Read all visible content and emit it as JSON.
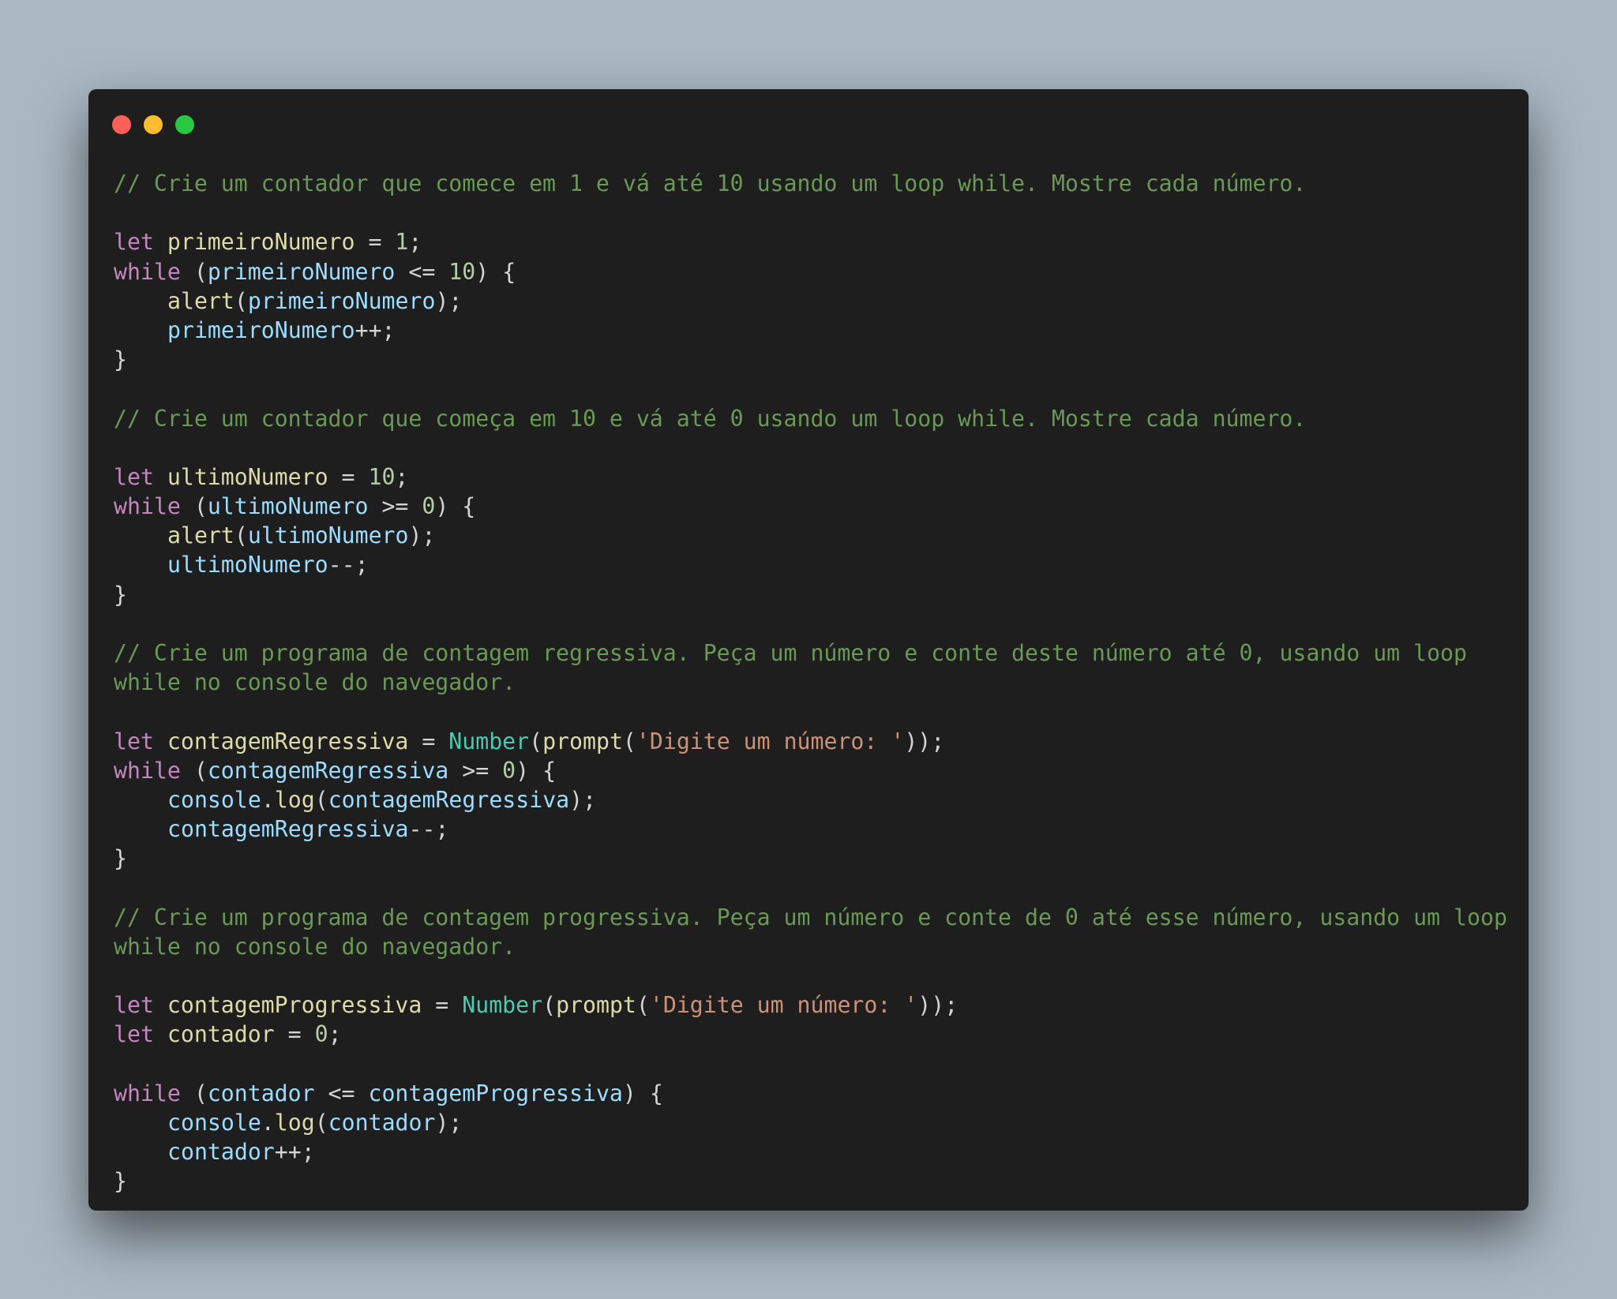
{
  "window": {
    "controls": {
      "close_color": "#ff5f57",
      "minimize_color": "#febc2e",
      "zoom_color": "#28c840"
    }
  },
  "code_lines": [
    [
      [
        "c",
        "// Crie um contador que comece em 1 e vá até 10 usando um loop while. Mostre cada número."
      ]
    ],
    [],
    [
      [
        "k",
        "let "
      ],
      [
        "v",
        "primeiroNumero"
      ],
      [
        "p",
        " = "
      ],
      [
        "n",
        "1"
      ],
      [
        "p",
        ";"
      ]
    ],
    [
      [
        "k",
        "while"
      ],
      [
        "p",
        " ("
      ],
      [
        "i",
        "primeiroNumero"
      ],
      [
        "p",
        " <= "
      ],
      [
        "n",
        "10"
      ],
      [
        "p",
        ") {"
      ]
    ],
    [
      [
        "indent",
        ""
      ],
      [
        "f",
        "alert"
      ],
      [
        "p",
        "("
      ],
      [
        "i",
        "primeiroNumero"
      ],
      [
        "p",
        ");"
      ]
    ],
    [
      [
        "indent",
        ""
      ],
      [
        "i",
        "primeiroNumero"
      ],
      [
        "p",
        "++;"
      ]
    ],
    [
      [
        "p",
        "}"
      ]
    ],
    [],
    [
      [
        "c",
        "// Crie um contador que começa em 10 e vá até 0 usando um loop while. Mostre cada número."
      ]
    ],
    [],
    [
      [
        "k",
        "let "
      ],
      [
        "v",
        "ultimoNumero"
      ],
      [
        "p",
        " = "
      ],
      [
        "n",
        "10"
      ],
      [
        "p",
        ";"
      ]
    ],
    [
      [
        "k",
        "while"
      ],
      [
        "p",
        " ("
      ],
      [
        "i",
        "ultimoNumero"
      ],
      [
        "p",
        " >= "
      ],
      [
        "n",
        "0"
      ],
      [
        "p",
        ") {"
      ]
    ],
    [
      [
        "indent",
        ""
      ],
      [
        "f",
        "alert"
      ],
      [
        "p",
        "("
      ],
      [
        "i",
        "ultimoNumero"
      ],
      [
        "p",
        ");"
      ]
    ],
    [
      [
        "indent",
        ""
      ],
      [
        "i",
        "ultimoNumero"
      ],
      [
        "p",
        "--;"
      ]
    ],
    [
      [
        "p",
        "}"
      ]
    ],
    [],
    [
      [
        "c",
        "// Crie um programa de contagem regressiva. Peça um número e conte deste número até 0, usando um loop"
      ]
    ],
    [
      [
        "c",
        "while no console do navegador."
      ]
    ],
    [],
    [
      [
        "k",
        "let "
      ],
      [
        "v",
        "contagemRegressiva"
      ],
      [
        "p",
        " = "
      ],
      [
        "t",
        "Number"
      ],
      [
        "p",
        "("
      ],
      [
        "f",
        "prompt"
      ],
      [
        "p",
        "("
      ],
      [
        "s",
        "'Digite um número: '"
      ],
      [
        "p",
        "));"
      ]
    ],
    [
      [
        "k",
        "while"
      ],
      [
        "p",
        " ("
      ],
      [
        "i",
        "contagemRegressiva"
      ],
      [
        "p",
        " >= "
      ],
      [
        "n",
        "0"
      ],
      [
        "p",
        ") {"
      ]
    ],
    [
      [
        "indent",
        ""
      ],
      [
        "i",
        "console"
      ],
      [
        "p",
        "."
      ],
      [
        "f",
        "log"
      ],
      [
        "p",
        "("
      ],
      [
        "i",
        "contagemRegressiva"
      ],
      [
        "p",
        ");"
      ]
    ],
    [
      [
        "indent",
        ""
      ],
      [
        "i",
        "contagemRegressiva"
      ],
      [
        "p",
        "--;"
      ]
    ],
    [
      [
        "p",
        "}"
      ]
    ],
    [],
    [
      [
        "c",
        "// Crie um programa de contagem progressiva. Peça um número e conte de 0 até esse número, usando um loop"
      ]
    ],
    [
      [
        "c",
        "while no console do navegador."
      ]
    ],
    [],
    [
      [
        "k",
        "let "
      ],
      [
        "v",
        "contagemProgressiva"
      ],
      [
        "p",
        " = "
      ],
      [
        "t",
        "Number"
      ],
      [
        "p",
        "("
      ],
      [
        "f",
        "prompt"
      ],
      [
        "p",
        "("
      ],
      [
        "s",
        "'Digite um número: '"
      ],
      [
        "p",
        "));"
      ]
    ],
    [
      [
        "k",
        "let "
      ],
      [
        "v",
        "contador"
      ],
      [
        "p",
        " = "
      ],
      [
        "n",
        "0"
      ],
      [
        "p",
        ";"
      ]
    ],
    [],
    [
      [
        "k",
        "while"
      ],
      [
        "p",
        " ("
      ],
      [
        "i",
        "contador"
      ],
      [
        "p",
        " <= "
      ],
      [
        "i",
        "contagemProgressiva"
      ],
      [
        "p",
        ") {"
      ]
    ],
    [
      [
        "indent",
        ""
      ],
      [
        "i",
        "console"
      ],
      [
        "p",
        "."
      ],
      [
        "f",
        "log"
      ],
      [
        "p",
        "("
      ],
      [
        "i",
        "contador"
      ],
      [
        "p",
        ");"
      ]
    ],
    [
      [
        "indent",
        ""
      ],
      [
        "i",
        "contador"
      ],
      [
        "p",
        "++;"
      ]
    ],
    [
      [
        "p",
        "}"
      ]
    ]
  ]
}
